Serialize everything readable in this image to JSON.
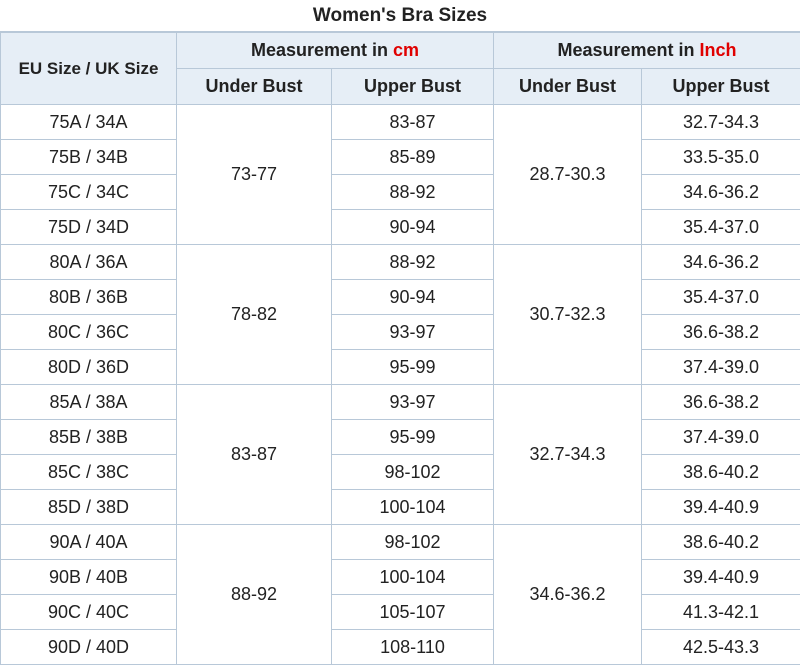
{
  "title": "Women's Bra Sizes",
  "header": {
    "eu_uk": "EU Size / UK Size",
    "cm_group_prefix": "Measurement in ",
    "cm_unit": "cm",
    "inch_group_prefix": "Measurement in ",
    "inch_unit": "Inch",
    "under_bust": "Under Bust",
    "upper_bust": "Upper Bust"
  },
  "colors": {
    "header_bg": "#e6eef6",
    "border": "#b8c8d8",
    "unit_red": "#e00000"
  },
  "groups": [
    {
      "under_cm": "73-77",
      "under_inch": "28.7-30.3",
      "rows": [
        {
          "size": "75A / 34A",
          "upper_cm": "83-87",
          "upper_inch": "32.7-34.3"
        },
        {
          "size": "75B / 34B",
          "upper_cm": "85-89",
          "upper_inch": "33.5-35.0"
        },
        {
          "size": "75C / 34C",
          "upper_cm": "88-92",
          "upper_inch": "34.6-36.2"
        },
        {
          "size": "75D / 34D",
          "upper_cm": "90-94",
          "upper_inch": "35.4-37.0"
        }
      ]
    },
    {
      "under_cm": "78-82",
      "under_inch": "30.7-32.3",
      "rows": [
        {
          "size": "80A / 36A",
          "upper_cm": "88-92",
          "upper_inch": "34.6-36.2"
        },
        {
          "size": "80B / 36B",
          "upper_cm": "90-94",
          "upper_inch": "35.4-37.0"
        },
        {
          "size": "80C / 36C",
          "upper_cm": "93-97",
          "upper_inch": "36.6-38.2"
        },
        {
          "size": "80D / 36D",
          "upper_cm": "95-99",
          "upper_inch": "37.4-39.0"
        }
      ]
    },
    {
      "under_cm": "83-87",
      "under_inch": "32.7-34.3",
      "rows": [
        {
          "size": "85A / 38A",
          "upper_cm": "93-97",
          "upper_inch": "36.6-38.2"
        },
        {
          "size": "85B / 38B",
          "upper_cm": "95-99",
          "upper_inch": "37.4-39.0"
        },
        {
          "size": "85C / 38C",
          "upper_cm": "98-102",
          "upper_inch": "38.6-40.2"
        },
        {
          "size": "85D / 38D",
          "upper_cm": "100-104",
          "upper_inch": "39.4-40.9"
        }
      ]
    },
    {
      "under_cm": "88-92",
      "under_inch": "34.6-36.2",
      "rows": [
        {
          "size": "90A / 40A",
          "upper_cm": "98-102",
          "upper_inch": "38.6-40.2"
        },
        {
          "size": "90B / 40B",
          "upper_cm": "100-104",
          "upper_inch": "39.4-40.9"
        },
        {
          "size": "90C / 40C",
          "upper_cm": "105-107",
          "upper_inch": "41.3-42.1"
        },
        {
          "size": "90D / 40D",
          "upper_cm": "108-110",
          "upper_inch": "42.5-43.3"
        }
      ]
    }
  ]
}
